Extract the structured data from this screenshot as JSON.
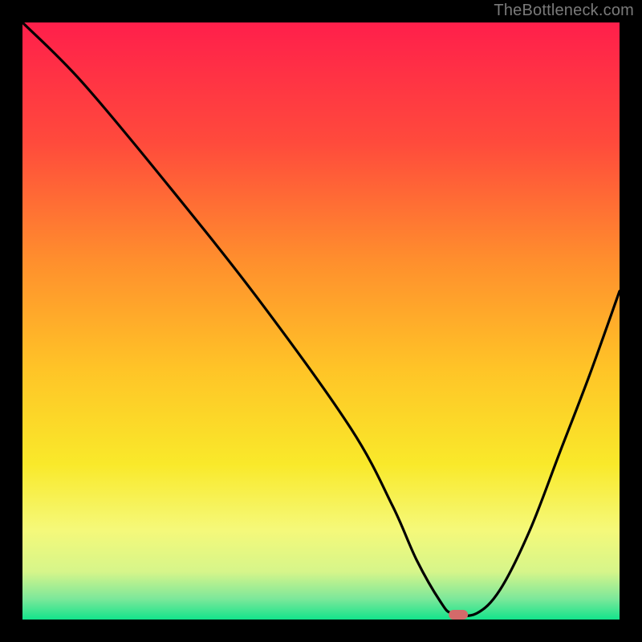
{
  "watermark": "TheBottleneck.com",
  "chart_data": {
    "type": "line",
    "title": "",
    "xlabel": "",
    "ylabel": "",
    "xlim": [
      0,
      100
    ],
    "ylim": [
      0,
      100
    ],
    "x": [
      0,
      10,
      25,
      40,
      55,
      62,
      66,
      70,
      72,
      76,
      80,
      85,
      90,
      95,
      100
    ],
    "values": [
      100,
      90,
      72,
      53,
      32,
      19,
      10,
      3,
      1,
      1,
      5,
      15,
      28,
      41,
      55
    ],
    "marker": {
      "x": 73,
      "y": 0.8
    },
    "gradient_stops": [
      {
        "offset": 0.0,
        "color": "#ff1f4b"
      },
      {
        "offset": 0.2,
        "color": "#ff4a3c"
      },
      {
        "offset": 0.4,
        "color": "#ff8f2d"
      },
      {
        "offset": 0.58,
        "color": "#ffc427"
      },
      {
        "offset": 0.74,
        "color": "#f9e92a"
      },
      {
        "offset": 0.85,
        "color": "#f5f97a"
      },
      {
        "offset": 0.92,
        "color": "#d6f58a"
      },
      {
        "offset": 0.965,
        "color": "#7de89a"
      },
      {
        "offset": 1.0,
        "color": "#13e38b"
      }
    ]
  }
}
